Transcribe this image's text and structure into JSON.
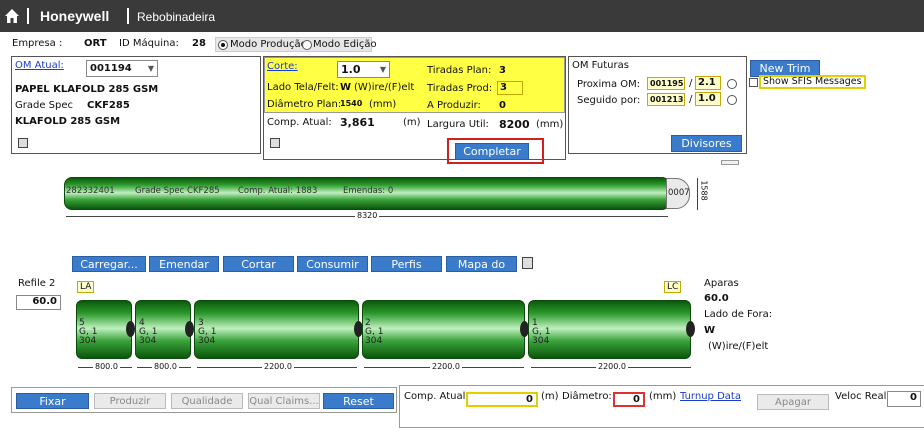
{
  "header": {
    "brand": "Honeywell",
    "app": "Rebobinadeira"
  },
  "company": {
    "empresa_label": "Empresa :",
    "empresa_value": "ORT",
    "maquina_label": "ID Máquina:",
    "maquina_value": "28"
  },
  "mode": {
    "producao": "Modo Produção",
    "edicao": "Modo Edição"
  },
  "om": {
    "link": "OM Atual:",
    "value": "001194",
    "product": "PAPEL KLAFOLD 285 GSM",
    "grade_label": "Grade Spec",
    "grade_value": "CKF285",
    "product2": "KLAFOLD 285 GSM"
  },
  "center": {
    "corte_label": "Corte:",
    "corte_value": "1.0",
    "lado_label": "Lado Tela/Felt:",
    "lado_value": "W",
    "lado_hint": "(W)ire/(F)elt",
    "diam_label": "Diâmetro Plan:",
    "diam_value": "1540",
    "diam_unit": "(mm)",
    "tiradas_plan_label": "Tiradas Plan:",
    "tiradas_plan_value": "3",
    "tiradas_prod_label": "Tiradas Prod:",
    "tiradas_prod_value": "3",
    "produzir_label": "A Produzir:",
    "produzir_value": "0",
    "comp_label": "Comp. Atual:",
    "comp_value": "3,861",
    "comp_unit": "(m)",
    "largura_label": "Largura Util:",
    "largura_value": "8200",
    "largura_unit": "(mm)",
    "completar": "Completar"
  },
  "futuras": {
    "title": "OM Futuras",
    "proxima_label": "Proxima OM:",
    "proxima_value": "001195",
    "proxima_ratio": "2.1",
    "seguido_label": "Seguido por:",
    "seguido_value": "001213",
    "seguido_ratio": "1.0",
    "slash": "/",
    "divisores": "Divisores"
  },
  "right": {
    "new_trim": "New Trim",
    "show_sfis": "Show SFIS Messages"
  },
  "jumbo": {
    "text_id": "282332401",
    "text_grade": "Grade Spec CKF285",
    "text_comp": "Comp. Atual: 1883",
    "text_emendas": "Emendas: 0",
    "end_label": "0007",
    "diam": "1588",
    "length": "8320"
  },
  "actions": [
    "Carregar...",
    "Emendar",
    "Cortar Manta",
    "Consumir",
    "Perfis",
    "Mapa do Rolo"
  ],
  "refile": {
    "label": "Refile 2",
    "value": "60.0"
  },
  "sides": {
    "left": "LA",
    "right": "LC"
  },
  "rolls": [
    {
      "l1": "5",
      "l2": "G, 1",
      "l3": "304",
      "width": "800.0"
    },
    {
      "l1": "4",
      "l2": "G, 1",
      "l3": "304",
      "width": "800.0"
    },
    {
      "l1": "3",
      "l2": "G, 1",
      "l3": "304",
      "width": "2200.0"
    },
    {
      "l1": "2",
      "l2": "G, 1",
      "l3": "304",
      "width": "2200.0"
    },
    {
      "l1": "1",
      "l2": "G, 1",
      "l3": "304",
      "width": "2200.0"
    }
  ],
  "aparas": {
    "label": "Aparas",
    "value": "60.0",
    "lado_label": "Lado de Fora:",
    "lado_value": "W",
    "hint": "(W)ire/(F)elt"
  },
  "bottom": {
    "fixar": "Fixar Posição",
    "produzir": "Produzir",
    "qualidade": "Qualidade",
    "qual_claims": "Qual Claims...",
    "reset": "Reset",
    "comp_label": "Comp. Atual:",
    "comp_value": "0",
    "comp_unit": "(m)",
    "diam_label": "Diâmetro:",
    "diam_value": "0",
    "diam_unit": "(mm)",
    "turnup": "Turnup Data",
    "apagar": "Apagar",
    "veloc_label": "Veloc Real:",
    "veloc_value": "0"
  }
}
